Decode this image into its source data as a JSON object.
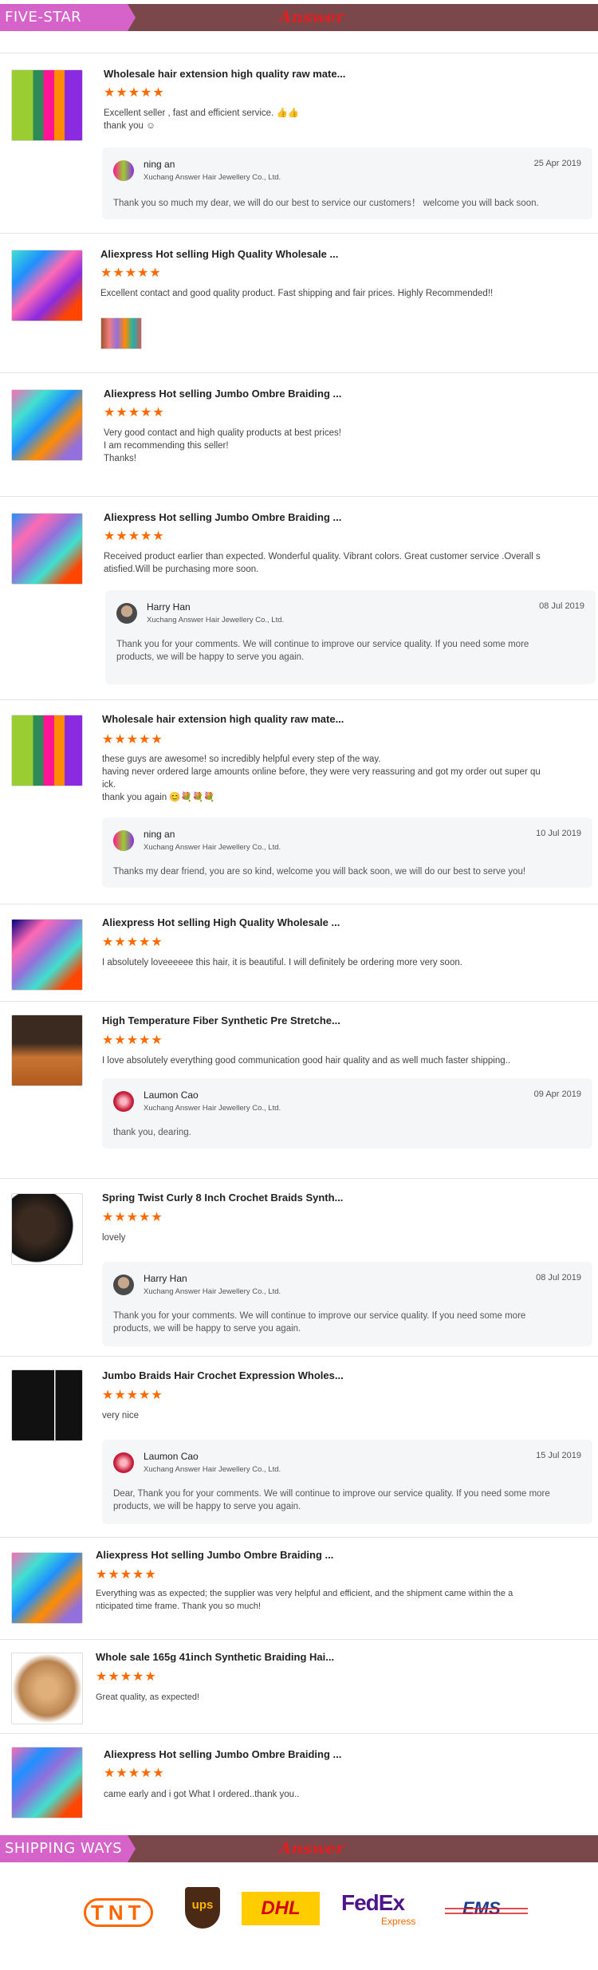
{
  "header": {
    "section_label": "FIVE-STAR RATING",
    "logo_text": "Answer"
  },
  "footer": {
    "section_label": "SHIPPING WAYS",
    "logo_text": "Answer",
    "carriers": [
      {
        "name": "TNT"
      },
      {
        "name": "UPS"
      },
      {
        "name": "DHL"
      },
      {
        "name": "FedEx",
        "sub": "Express"
      },
      {
        "name": "EMS"
      }
    ]
  },
  "stars": "★★★★★",
  "reviews": [
    {
      "title": "Wholesale hair extension high quality raw mate...",
      "text": "Excellent seller , fast and efficient service. 👍👍\nthank you ☺",
      "reply": {
        "name": "ning an",
        "company": "Xuchang Answer Hair Jewellery Co., Ltd.",
        "date": "25 Apr 2019",
        "text": "Thank you so much my dear, we will do our best to service our customers！ welcome you will back soon."
      }
    },
    {
      "title": "Aliexpress Hot selling High Quality Wholesale ...",
      "text": "Excellent contact and good quality product. Fast shipping and fair prices. Highly Recommended!!"
    },
    {
      "title": "Aliexpress Hot selling Jumbo Ombre Braiding ...",
      "text": "Very good contact and high quality products at best prices!\nI am recommending this seller!\nThanks!"
    },
    {
      "title": "Aliexpress Hot selling Jumbo Ombre Braiding ...",
      "text": "Received product earlier than expected. Wonderful quality. Vibrant colors. Great customer service .Overall s\natisfied.Will be purchasing more soon.",
      "reply": {
        "name": "Harry Han",
        "company": "Xuchang Answer Hair Jewellery Co., Ltd.",
        "date": "08 Jul 2019",
        "text": "Thank you for your comments. We will continue to improve our service quality. If you need some more\nproducts, we will be happy to serve you again."
      }
    },
    {
      "title": "Wholesale hair extension high quality raw mate...",
      "text": "these guys are awesome! so incredibly helpful every step of the way.\nhaving never ordered large amounts online before, they were very reassuring and got my order out super qu\nick.\nthank you again 😊💐💐💐",
      "reply": {
        "name": "ning an",
        "company": "Xuchang Answer Hair Jewellery Co., Ltd.",
        "date": "10 Jul 2019",
        "text": "Thanks my dear friend, you are so kind, welcome you will back soon, we will do our best to serve you!"
      }
    },
    {
      "title": "Aliexpress Hot selling High Quality Wholesale ...",
      "text": "I absolutely loveeeeee this hair, it is beautiful. I will definitely be ordering more very soon."
    },
    {
      "title": "High Temperature Fiber Synthetic Pre Stretche...",
      "text": "I love absolutely everything good communication good hair quality and as well much faster shipping..",
      "reply": {
        "name": "Laumon Cao",
        "company": "Xuchang Answer Hair Jewellery Co., Ltd.",
        "date": "09 Apr 2019",
        "text": "thank you, dearing."
      }
    },
    {
      "title": "Spring Twist Curly 8 Inch Crochet Braids Synth...",
      "text": "lovely",
      "reply": {
        "name": "Harry Han",
        "company": "Xuchang Answer Hair Jewellery Co., Ltd.",
        "date": "08 Jul 2019",
        "text": "Thank you for your comments. We will continue to improve our service quality. If you need some more\nproducts, we will be happy to serve you again."
      }
    },
    {
      "title": "Jumbo Braids Hair Crochet Expression Wholes...",
      "text": "very nice",
      "reply": {
        "name": "Laumon Cao",
        "company": "Xuchang Answer Hair Jewellery Co., Ltd.",
        "date": "15 Jul 2019",
        "text": "Dear, Thank you for your comments. We will continue to improve our service quality. If you need some more\nproducts, we will be happy to serve you again."
      }
    },
    {
      "title": "Aliexpress Hot selling Jumbo Ombre Braiding ...",
      "text": "Everything was as expected; the supplier was very helpful and efficient, and the shipment came within the a\nnticipated time frame. Thank you so much!"
    },
    {
      "title": "Whole sale 165g 41inch Synthetic Braiding Hai...",
      "text": "Great quality, as expected!"
    },
    {
      "title": "Aliexpress Hot selling Jumbo Ombre Braiding ...",
      "text": "came early and i got What I ordered..thank you.."
    }
  ]
}
